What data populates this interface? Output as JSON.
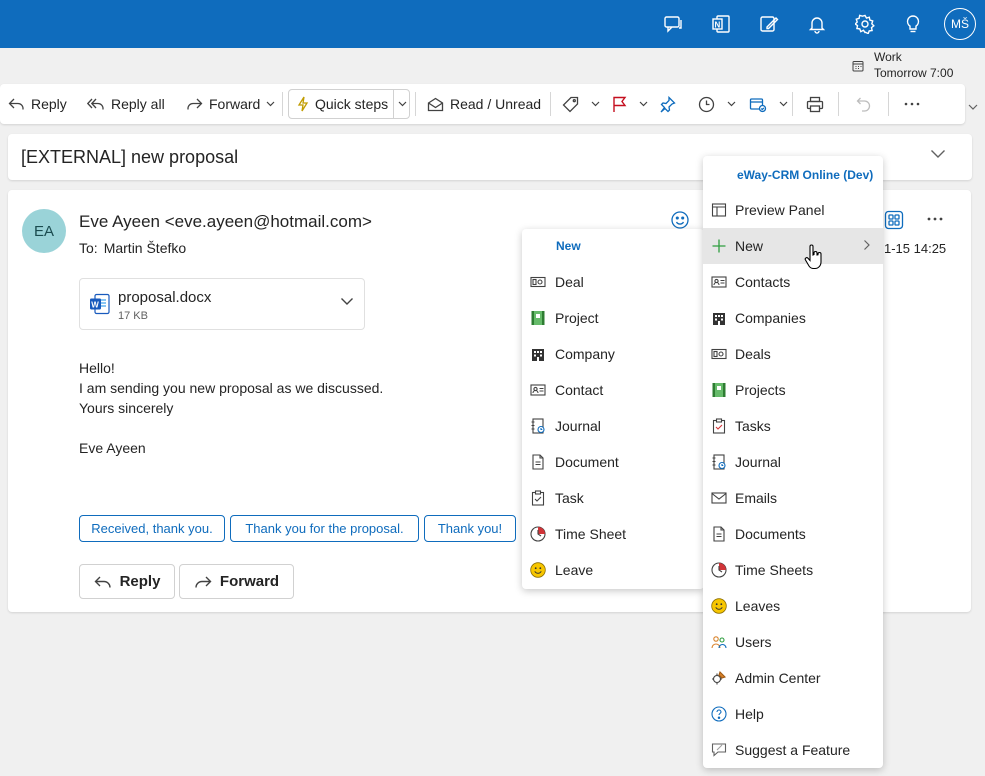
{
  "topbar": {
    "icons": [
      "chat-icon",
      "onenote-icon",
      "edit-note-icon",
      "bell-icon",
      "gear-icon",
      "lightbulb-icon"
    ],
    "avatar": "MŠ",
    "color": "#0f6cbd"
  },
  "reminder": {
    "title": "Work",
    "time": "Tomorrow 7:00"
  },
  "toolbar": {
    "reply": "Reply",
    "reply_all": "Reply all",
    "forward": "Forward",
    "quick_steps": "Quick steps",
    "read_unread": "Read / Unread"
  },
  "mail": {
    "subject": "[EXTERNAL] new proposal",
    "initials": "EA",
    "from": "Eve Ayeen <eve.ayeen@hotmail.com>",
    "to_label": "To:",
    "to": "Martin Štefko",
    "date": "1-15 14:25",
    "attachment": {
      "name": "proposal.docx",
      "size": "17 KB"
    },
    "body": [
      "Hello!",
      "I am sending you new proposal as we discussed.",
      "Yours sincerely",
      "",
      "Eve Ayeen"
    ],
    "suggestions": [
      "Received, thank you.",
      "Thank you for the proposal.",
      "Thank you!"
    ],
    "reply": "Reply",
    "forward": "Forward"
  },
  "submenu": {
    "header": "New",
    "items": [
      {
        "label": "Deal",
        "icon": "deal-icon"
      },
      {
        "label": "Project",
        "icon": "project-icon"
      },
      {
        "label": "Company",
        "icon": "company-icon"
      },
      {
        "label": "Contact",
        "icon": "contact-icon"
      },
      {
        "label": "Journal",
        "icon": "journal-icon"
      },
      {
        "label": "Document",
        "icon": "document-icon"
      },
      {
        "label": "Task",
        "icon": "task-icon"
      },
      {
        "label": "Time Sheet",
        "icon": "timesheet-icon"
      },
      {
        "label": "Leave",
        "icon": "leave-icon"
      }
    ]
  },
  "mainmenu": {
    "header": "eWay-CRM Online (Dev)",
    "items": [
      {
        "label": "Preview Panel",
        "icon": "preview-panel-icon"
      },
      {
        "label": "New",
        "icon": "plus-icon"
      },
      {
        "label": "Contacts",
        "icon": "contact-icon"
      },
      {
        "label": "Companies",
        "icon": "company-icon"
      },
      {
        "label": "Deals",
        "icon": "deal-icon"
      },
      {
        "label": "Projects",
        "icon": "project-icon"
      },
      {
        "label": "Tasks",
        "icon": "task-icon"
      },
      {
        "label": "Journal",
        "icon": "journal-icon"
      },
      {
        "label": "Emails",
        "icon": "email-icon"
      },
      {
        "label": "Documents",
        "icon": "document-icon"
      },
      {
        "label": "Time Sheets",
        "icon": "timesheet-icon"
      },
      {
        "label": "Leaves",
        "icon": "leave-icon"
      },
      {
        "label": "Users",
        "icon": "users-icon"
      },
      {
        "label": "Admin Center",
        "icon": "admin-center-icon"
      },
      {
        "label": "Help",
        "icon": "help-icon"
      },
      {
        "label": "Suggest a Feature",
        "icon": "suggest-feature-icon"
      }
    ]
  }
}
